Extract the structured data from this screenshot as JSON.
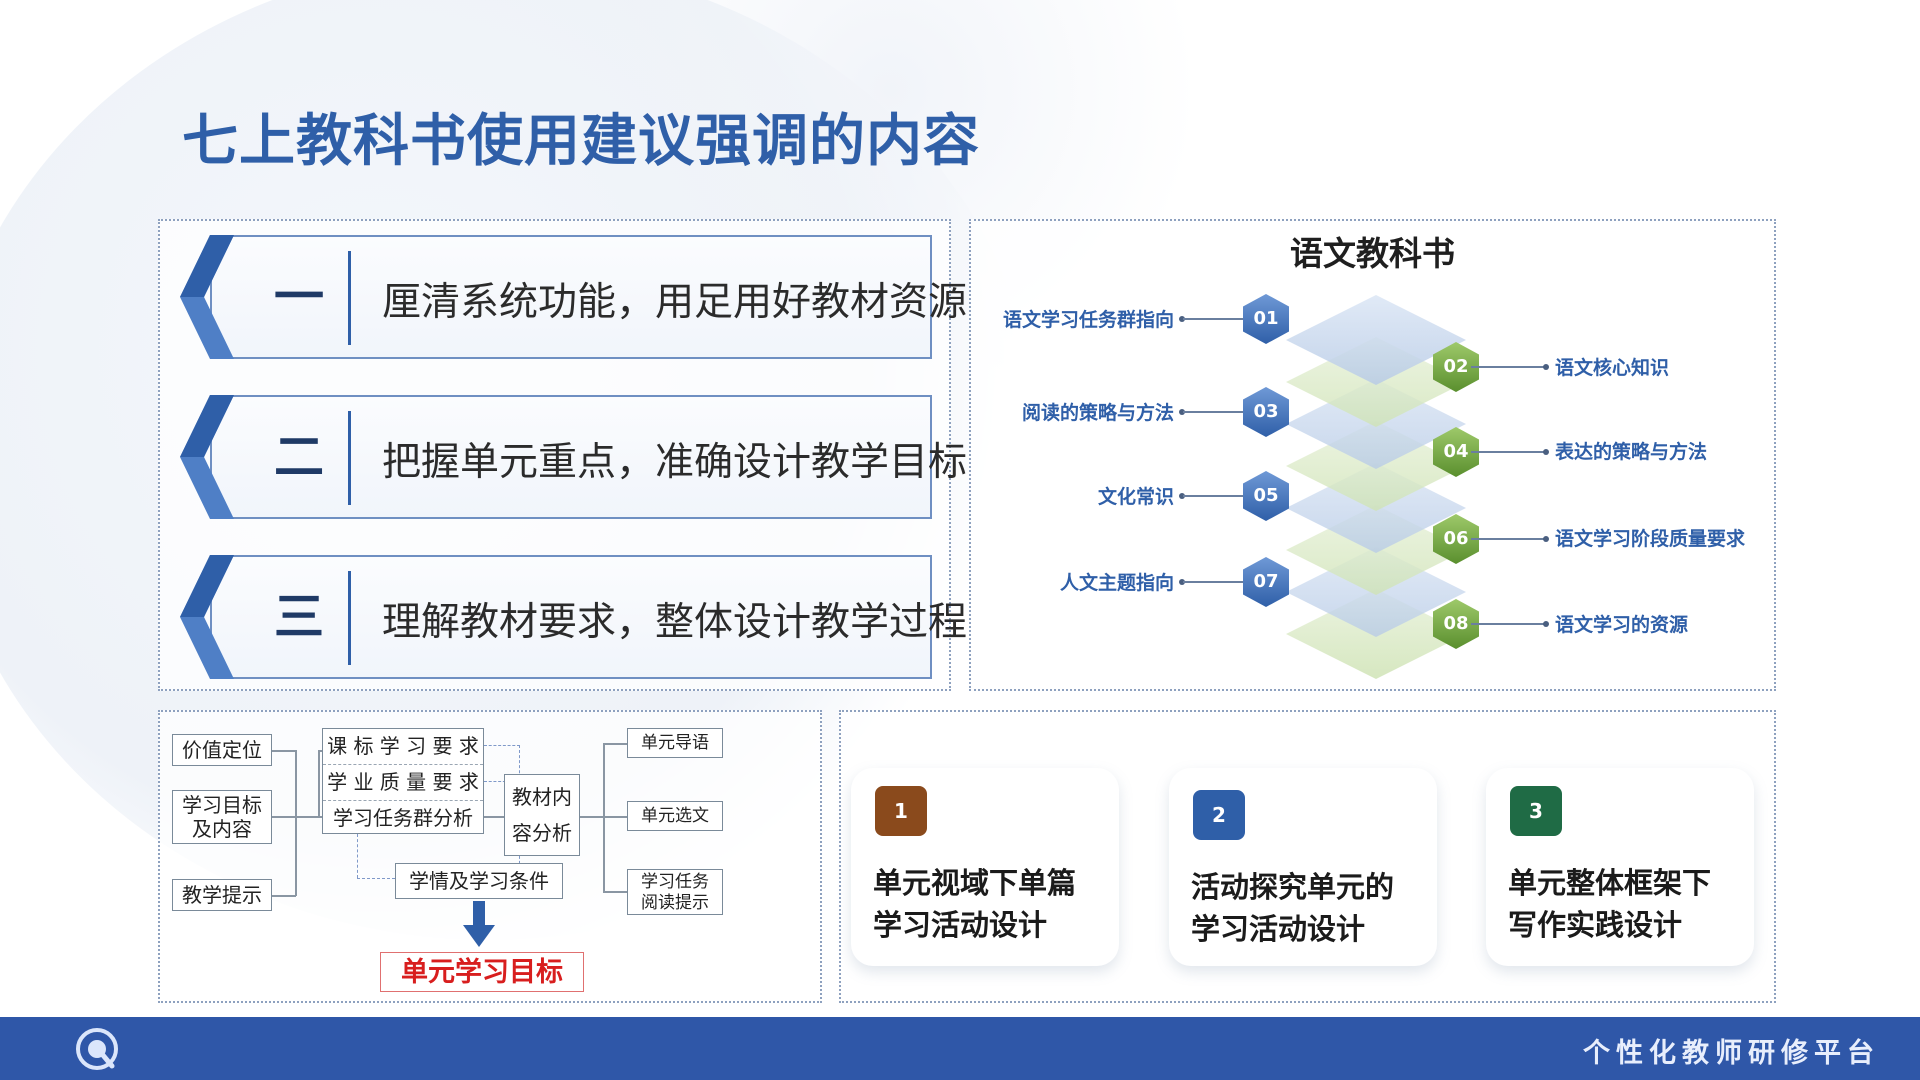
{
  "title": "七上教科书使用建议强调的内容",
  "left_items": [
    {
      "num": "一",
      "text": "厘清系统功能，用足用好教材资源"
    },
    {
      "num": "二",
      "text": "把握单元重点，准确设计教学目标"
    },
    {
      "num": "三",
      "text": "理解教材要求，整体设计教学过程"
    }
  ],
  "textbook": {
    "title": "语文教科书",
    "nodes": [
      {
        "num": "01",
        "label": "语文学习任务群指向",
        "side": "left",
        "color": "blue"
      },
      {
        "num": "02",
        "label": "语文核心知识",
        "side": "right",
        "color": "green"
      },
      {
        "num": "03",
        "label": "阅读的策略与方法",
        "side": "left",
        "color": "blue"
      },
      {
        "num": "04",
        "label": "表达的策略与方法",
        "side": "right",
        "color": "green"
      },
      {
        "num": "05",
        "label": "文化常识",
        "side": "left",
        "color": "blue"
      },
      {
        "num": "06",
        "label": "语文学习阶段质量要求",
        "side": "right",
        "color": "green"
      },
      {
        "num": "07",
        "label": "人文主题指向",
        "side": "left",
        "color": "blue"
      },
      {
        "num": "08",
        "label": "语文学习的资源",
        "side": "right",
        "color": "green"
      }
    ]
  },
  "flowchart": {
    "left": [
      "价值定位",
      "学习目标及内容",
      "教学提示"
    ],
    "middle": [
      "课 标 学 习 要 求",
      "学 业 质 量 要 求",
      "学习任务群分析"
    ],
    "center": "教材内容分析",
    "center_lines": [
      "教材内",
      "容分析"
    ],
    "right": [
      "单元导语",
      "单元选文",
      "学习任务阅读提示"
    ],
    "right_lines": [
      [
        "单元导语"
      ],
      [
        "单元选文"
      ],
      [
        "学习任务",
        "阅读提示"
      ]
    ],
    "left_lines": [
      [
        "价值定位"
      ],
      [
        "学习目标",
        "及内容"
      ],
      [
        "教学提示"
      ]
    ],
    "situation": "学情及学习条件",
    "target": "单元学习目标"
  },
  "cards": [
    {
      "num": "1",
      "lines": [
        "单元视域下单篇",
        "学习活动设计"
      ],
      "color": "#8a4a1c"
    },
    {
      "num": "2",
      "lines": [
        "活动探究单元的",
        "学习活动设计"
      ],
      "color": "#2f5fa8"
    },
    {
      "num": "3",
      "lines": [
        "单元整体框架下",
        "写作实践设计"
      ],
      "color": "#1f6b45"
    }
  ],
  "footer": {
    "platform": "个性化教师研修平台",
    "logo_icon": "platform-logo-icon"
  },
  "colors": {
    "accent": "#2f5fa8",
    "footer": "#2f57a8",
    "target": "#d81e1e"
  }
}
